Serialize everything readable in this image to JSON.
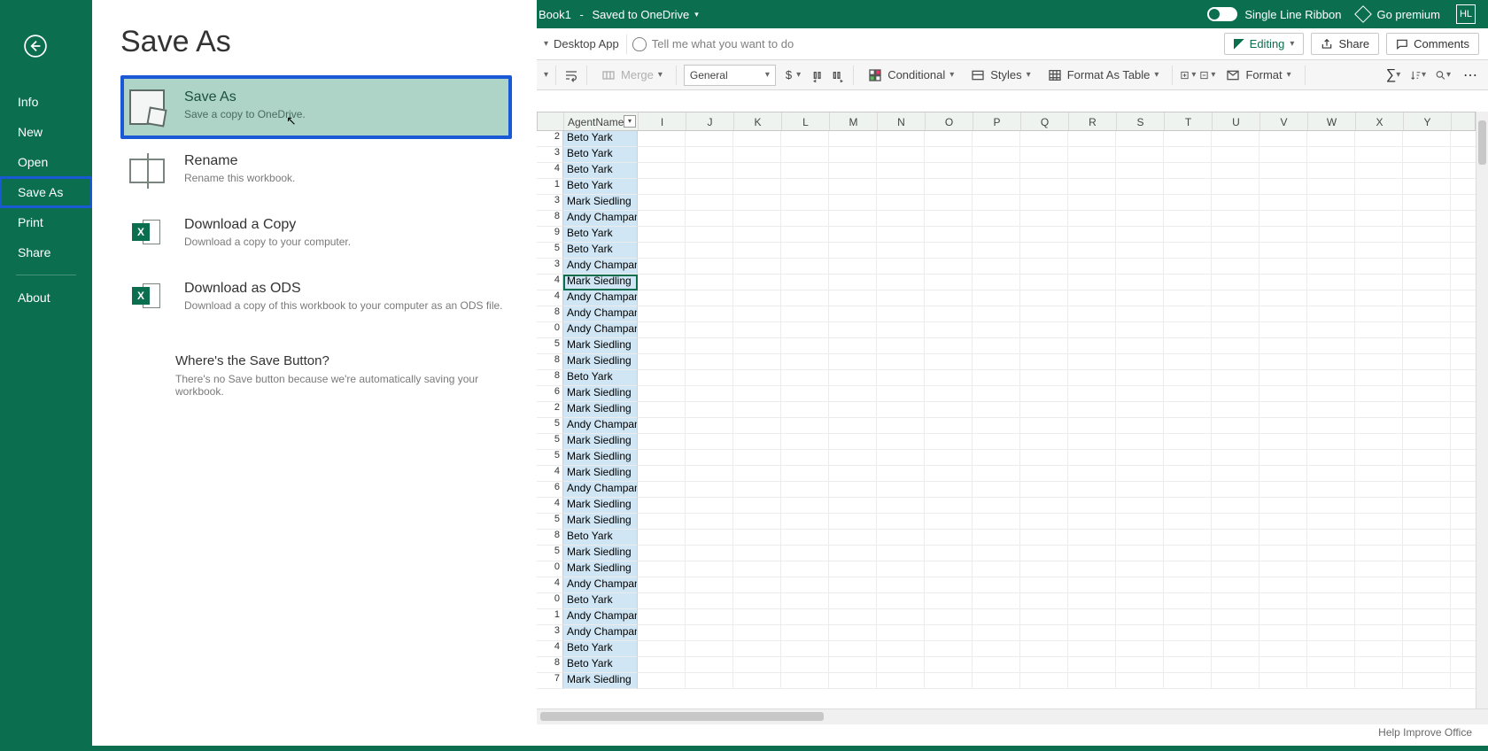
{
  "titlebar": {
    "doc_name": "Book1",
    "saved_label": "Saved to OneDrive",
    "single_line_ribbon": "Single Line Ribbon",
    "go_premium": "Go premium",
    "user_initials": "HL"
  },
  "sidebar": {
    "items": [
      "Info",
      "New",
      "Open",
      "Save As",
      "Print",
      "Share",
      "About"
    ],
    "selected_index": 3
  },
  "pane": {
    "title": "Save As",
    "options": [
      {
        "title": "Save As",
        "desc": "Save a copy to OneDrive.",
        "selected": true,
        "icon": "save"
      },
      {
        "title": "Rename",
        "desc": "Rename this workbook.",
        "icon": "rename"
      },
      {
        "title": "Download a Copy",
        "desc": "Download a copy to your computer.",
        "icon": "xls"
      },
      {
        "title": "Download as ODS",
        "desc": "Download a copy of this workbook to your computer as an ODS file.",
        "icon": "xls"
      }
    ],
    "footer": {
      "title": "Where's the Save Button?",
      "desc": "There's no Save button because we're automatically saving your workbook."
    }
  },
  "cmdbar": {
    "desktop": "Desktop App",
    "tellme": "Tell me what you want to do",
    "editing": "Editing",
    "share": "Share",
    "comments": "Comments"
  },
  "toolbar": {
    "merge": "Merge",
    "number_format": "General",
    "currency": "$",
    "conditional": "Conditional",
    "styles": "Styles",
    "format_table": "Format As Table",
    "format": "Format"
  },
  "sheet": {
    "header_cell": "AgentName",
    "columns": [
      "I",
      "J",
      "K",
      "L",
      "M",
      "N",
      "O",
      "P",
      "Q",
      "R",
      "S",
      "T",
      "U",
      "V",
      "W",
      "X",
      "Y"
    ],
    "rows": [
      {
        "n": "2",
        "name": "Beto Yark"
      },
      {
        "n": "3",
        "name": "Beto Yark"
      },
      {
        "n": "4",
        "name": "Beto Yark"
      },
      {
        "n": "1",
        "name": "Beto Yark"
      },
      {
        "n": "3",
        "name": "Mark Siedling"
      },
      {
        "n": "8",
        "name": "Andy Champan"
      },
      {
        "n": "9",
        "name": "Beto Yark"
      },
      {
        "n": "5",
        "name": "Beto Yark"
      },
      {
        "n": "3",
        "name": "Andy Champan"
      },
      {
        "n": "4",
        "name": "Mark Siedling",
        "current": true
      },
      {
        "n": "4",
        "name": "Andy Champan"
      },
      {
        "n": "8",
        "name": "Andy Champan"
      },
      {
        "n": "0",
        "name": "Andy Champan"
      },
      {
        "n": "5",
        "name": "Mark Siedling"
      },
      {
        "n": "8",
        "name": "Mark Siedling"
      },
      {
        "n": "8",
        "name": "Beto Yark"
      },
      {
        "n": "6",
        "name": "Mark Siedling"
      },
      {
        "n": "2",
        "name": "Mark Siedling"
      },
      {
        "n": "5",
        "name": "Andy Champan"
      },
      {
        "n": "5",
        "name": "Mark Siedling"
      },
      {
        "n": "5",
        "name": "Mark Siedling"
      },
      {
        "n": "4",
        "name": "Mark Siedling"
      },
      {
        "n": "6",
        "name": "Andy Champan"
      },
      {
        "n": "4",
        "name": "Mark Siedling"
      },
      {
        "n": "5",
        "name": "Mark Siedling"
      },
      {
        "n": "8",
        "name": "Beto Yark"
      },
      {
        "n": "5",
        "name": "Mark Siedling"
      },
      {
        "n": "0",
        "name": "Mark Siedling"
      },
      {
        "n": "4",
        "name": "Andy Champan"
      },
      {
        "n": "0",
        "name": "Beto Yark"
      },
      {
        "n": "1",
        "name": "Andy Champan"
      },
      {
        "n": "3",
        "name": "Andy Champan"
      },
      {
        "n": "4",
        "name": "Beto Yark"
      },
      {
        "n": "8",
        "name": "Beto Yark"
      },
      {
        "n": "7",
        "name": "Mark Siedling"
      }
    ]
  },
  "statusbar": {
    "improve": "Help Improve Office"
  }
}
